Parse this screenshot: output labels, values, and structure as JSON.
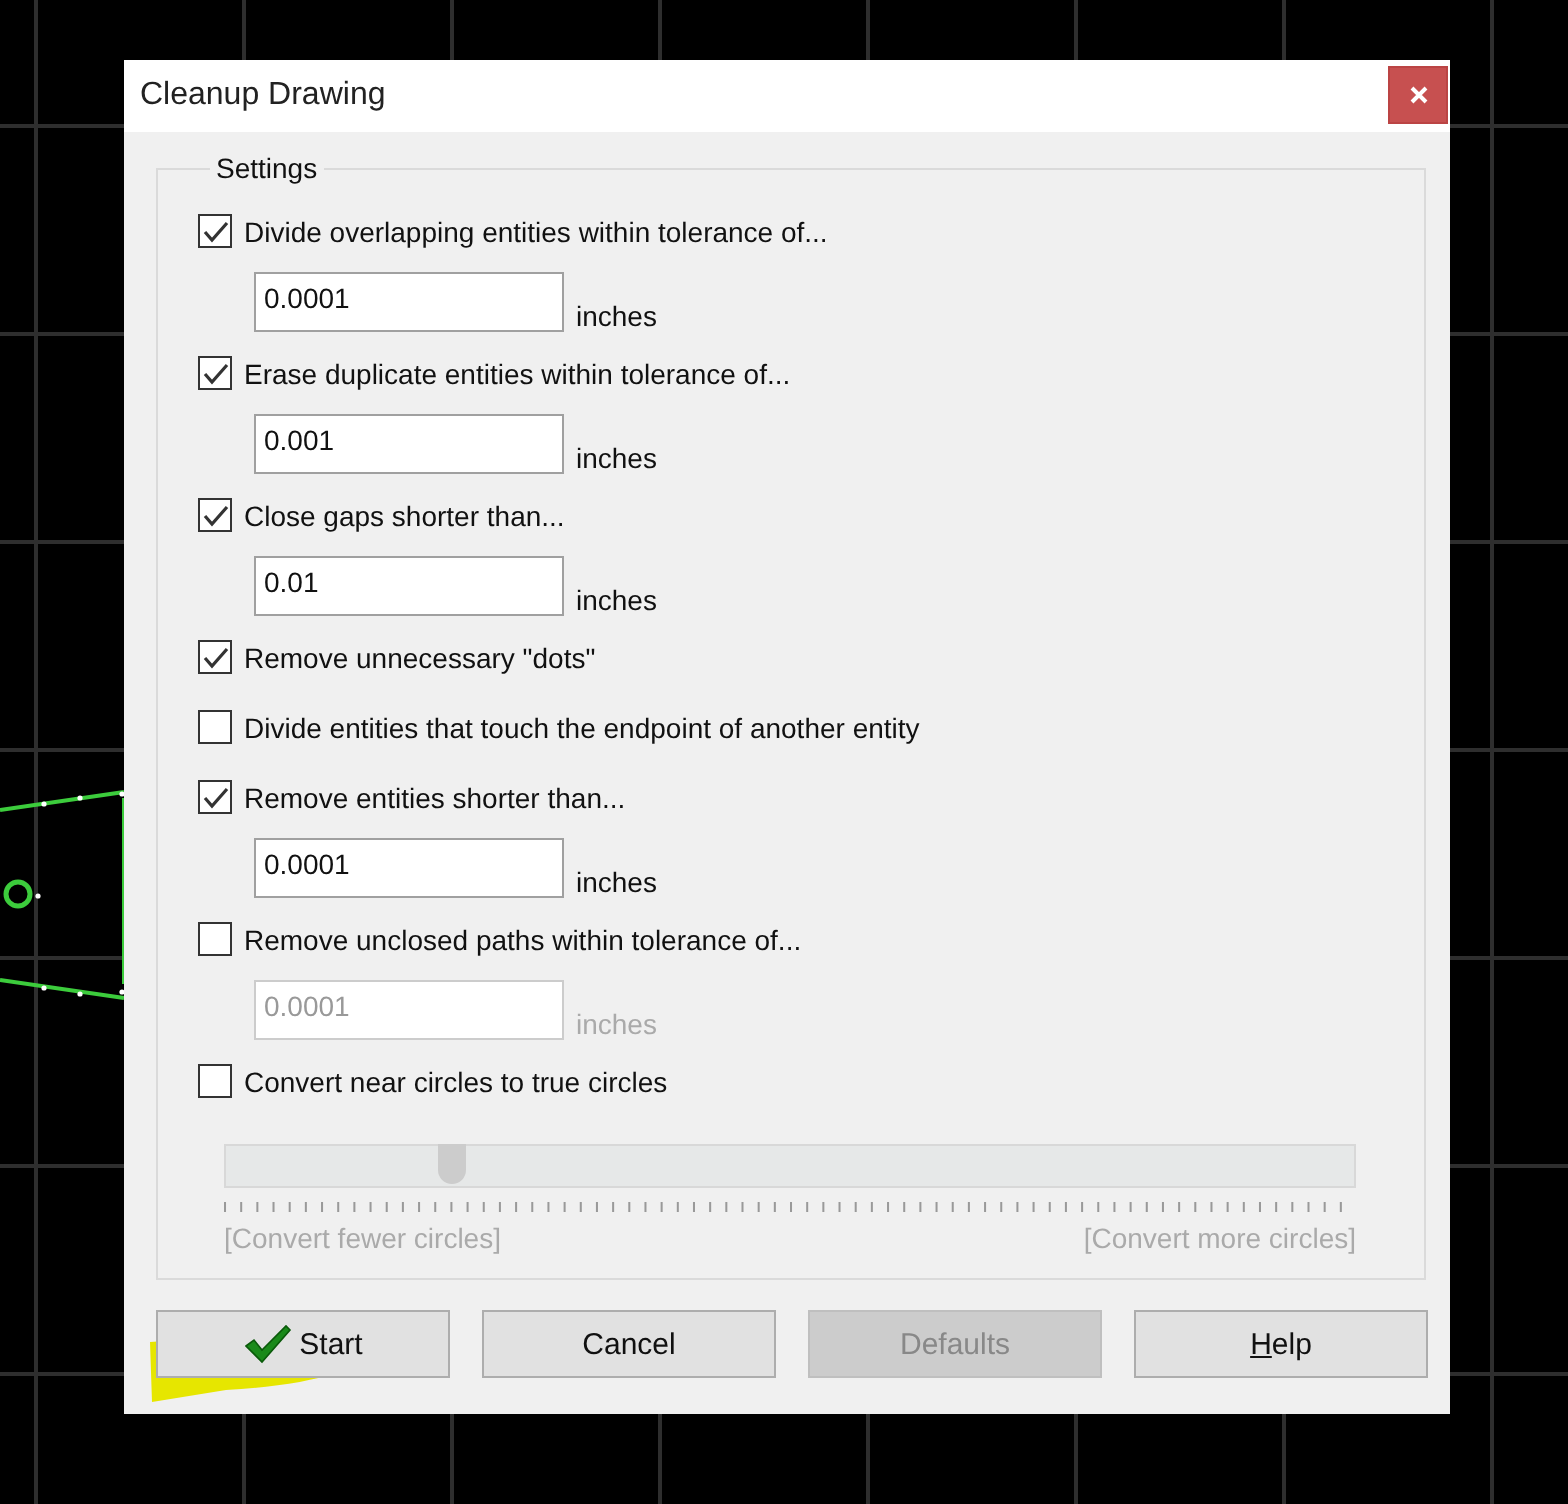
{
  "window": {
    "title": "Cleanup Drawing"
  },
  "settings": {
    "title": "Settings",
    "options": [
      {
        "kind": "field",
        "label": "Divide overlapping entities within tolerance of...",
        "checked": true,
        "value": "0.0001",
        "unit": "inches",
        "disabled": false
      },
      {
        "kind": "field",
        "label": "Erase duplicate entities within tolerance of...",
        "checked": true,
        "value": "0.001",
        "unit": "inches",
        "disabled": false
      },
      {
        "kind": "field",
        "label": "Close gaps shorter than...",
        "checked": true,
        "value": "0.01",
        "unit": "inches",
        "disabled": false
      },
      {
        "kind": "check",
        "label": "Remove unnecessary \"dots\"",
        "checked": true
      },
      {
        "kind": "check",
        "label": "Divide entities that touch the endpoint of another entity",
        "checked": false
      },
      {
        "kind": "field",
        "label": "Remove entities shorter than...",
        "checked": true,
        "value": "0.0001",
        "unit": "inches",
        "disabled": false
      },
      {
        "kind": "field",
        "label": "Remove unclosed paths within tolerance of...",
        "checked": false,
        "value": "0.0001",
        "unit": "inches",
        "disabled": true
      },
      {
        "kind": "check",
        "label": "Convert near circles to true circles",
        "checked": false
      }
    ],
    "slider": {
      "level": 0.2,
      "disabled": true,
      "min_label": "[Convert fewer circles]",
      "max_label": "[Convert more circles]"
    }
  },
  "buttons": [
    {
      "label": "Start",
      "disabled": false,
      "highlighted": true
    },
    {
      "label": "Cancel",
      "disabled": false,
      "highlighted": false
    },
    {
      "label": "Defaults",
      "disabled": true,
      "highlighted": false
    },
    {
      "label": "Help",
      "disabled": false,
      "highlighted": false,
      "mnemonic_underlined": true
    }
  ]
}
